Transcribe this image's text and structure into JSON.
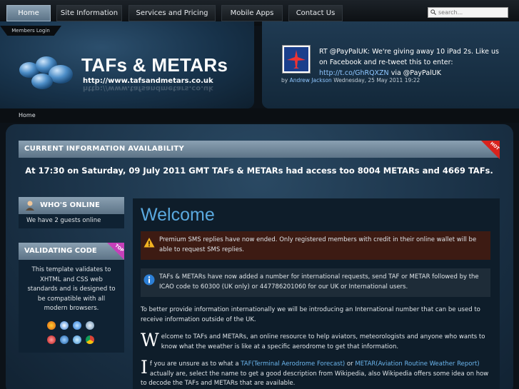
{
  "nav": {
    "items": [
      {
        "label": "Home",
        "active": true
      },
      {
        "label": "Site Information",
        "active": false
      },
      {
        "label": "Services and Pricing",
        "active": false
      },
      {
        "label": "Mobile Apps",
        "active": false
      },
      {
        "label": "Contact Us",
        "active": false
      }
    ],
    "search_placeholder": "search...",
    "members_login": "Members Login"
  },
  "header": {
    "logo_title": "TAFs & METARs",
    "logo_url": "http://www.tafsandmetars.co.uk",
    "tweet": {
      "text_before": "RT @PayPalUK: We're giving away 10 iPad 2s. Like us on Facebook and re-tweet this to enter: ",
      "link": "http://t.co/GhRQXZN",
      "text_after": " via @PayPalUK",
      "by": "by",
      "author": "Andrew Jackson",
      "date": "Wednesday, 25 May 2011 19:22"
    }
  },
  "breadcrumb": "Home",
  "info_bar": {
    "label": "CURRENT INFORMATION AVAILABILITY",
    "badge": "HOT",
    "headline": "At 17:30 on Saturday, 09 July 2011 GMT TAFs & METARs had access too 8004 METARs and 4669 TAFs."
  },
  "sidebar": {
    "whos_online_title": "WHO'S ONLINE",
    "whos_online_text": "We have 2 guests online",
    "validating_title": "VALIDATING CODE",
    "validating_badge": "TOP",
    "validating_text": "This template validates to XHTML and CSS web standards and is designed to be compatible with all modern browsers."
  },
  "content": {
    "title": "Welcome",
    "warn_notice": "Premium SMS replies have now ended. Only registered members with credit in their online wallet will be able to request SMS replies.",
    "info_notice": "TAFs & METARs have now added a number for international requests, send TAF or METAR followed by the ICAO code to 60300 (UK only) or 447786201060 for our UK or International users.",
    "para1": "To better provide information internationally we will be introducing an International number that can be used to receive information outside of the UK.",
    "para2_cap": "W",
    "para2": "elcome to TAFs and METARs, an online resource to help aviators, meteorologists and anyone who wants to know what the weather is like at a specific aerodrome to get that information.",
    "para3_cap": "I",
    "para3_a": "f you are unsure as to what a ",
    "para3_link1": "TAF(Terminal Aerodrome Forecast)",
    "para3_b": " or ",
    "para3_link2": "METAR(Aviation Routine Weather Report)",
    "para3_c": " actually are, select the name to get a good description from Wikipedia, also Wikipedia offers some idea on how to decode the TAFs and METARs that are available."
  },
  "colors": {
    "accent_bar": "#7a93a8",
    "link": "#6cb6ee",
    "welcome": "#5aa9df",
    "warn_bg": "#3d1b13",
    "hot_badge": "#d9221c"
  }
}
